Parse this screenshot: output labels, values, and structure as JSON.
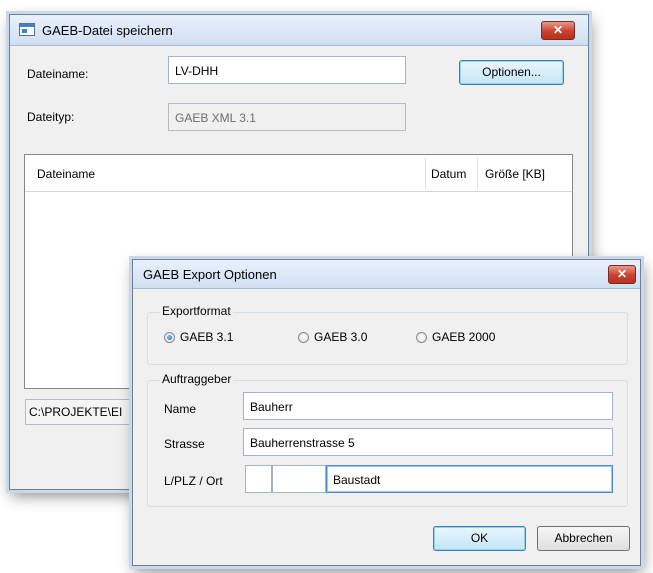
{
  "save_dialog": {
    "title": "GAEB-Datei speichern",
    "filename_label": "Dateiname:",
    "filename_value": "LV-DHH",
    "options_button": "Optionen...",
    "filetype_label": "Dateityp:",
    "filetype_value": "GAEB XML 3.1",
    "columns": [
      "Dateiname",
      "Datum",
      "Größe [KB]"
    ],
    "path_value": "C:\\PROJEKTE\\EI"
  },
  "options_dialog": {
    "title": "GAEB Export Optionen",
    "export_group": "Exportformat",
    "formats": [
      {
        "label": "GAEB 3.1",
        "checked": true
      },
      {
        "label": "GAEB 3.0",
        "checked": false
      },
      {
        "label": "GAEB 2000",
        "checked": false
      }
    ],
    "client_group": "Auftraggeber",
    "name_label": "Name",
    "name_value": "Bauherr",
    "street_label": "Strasse",
    "street_value": "Bauherrenstrasse 5",
    "city_label": "L/PLZ / Ort",
    "country_value": "",
    "zip_value": "",
    "city_value": "Baustadt",
    "ok_button": "OK",
    "cancel_button": "Abbrechen"
  },
  "icons": {
    "close": "close-icon",
    "window": "window-icon"
  },
  "colors": {
    "close_button": "#c9402e",
    "title_gradient_top": "#e9f1fb",
    "default_button_border": "#3c7fb1"
  }
}
